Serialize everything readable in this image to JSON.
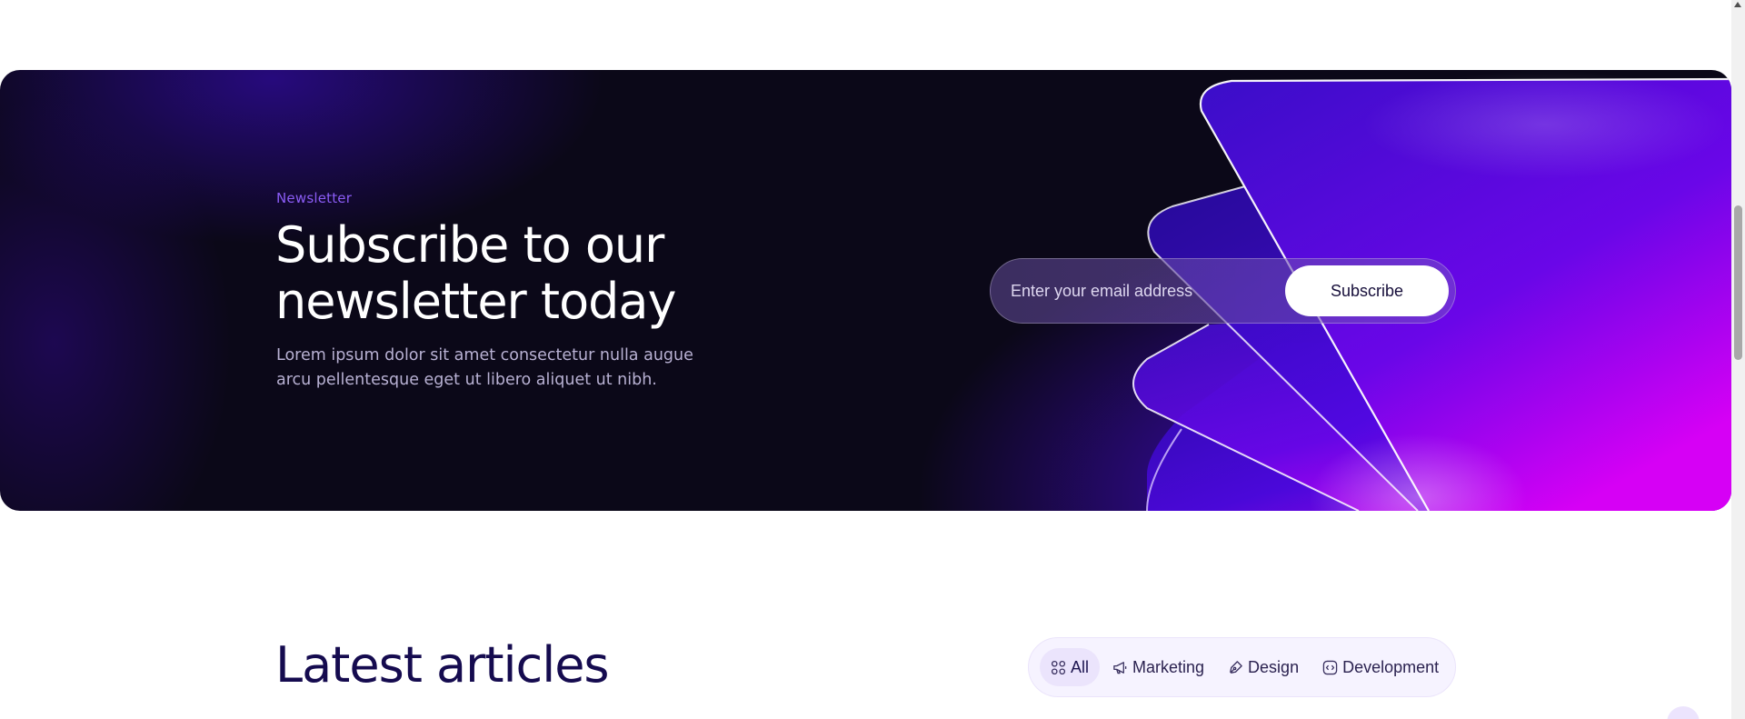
{
  "newsletter": {
    "eyebrow": "Newsletter",
    "title_line1": "Subscribe to our",
    "title_line2": "newsletter today",
    "description_line1": "Lorem ipsum dolor sit amet consectetur nulla augue",
    "description_line2": "arcu pellentesque eget ut libero aliquet ut nibh.",
    "email_placeholder": "Enter your email address",
    "email_value": "",
    "subscribe_label": "Subscribe"
  },
  "articles": {
    "title": "Latest articles",
    "filters": [
      {
        "label": "All",
        "icon": "grid-icon",
        "active": true
      },
      {
        "label": "Marketing",
        "icon": "megaphone-icon",
        "active": false
      },
      {
        "label": "Design",
        "icon": "pen-tool-icon",
        "active": false
      },
      {
        "label": "Development",
        "icon": "code-icon",
        "active": false
      }
    ]
  },
  "colors": {
    "banner_bg": "#0b0818",
    "accent_purple": "#8b5cf6",
    "magenta": "#d600f5",
    "heading_navy": "#150b4f",
    "filter_bg": "#f6f3ff"
  }
}
